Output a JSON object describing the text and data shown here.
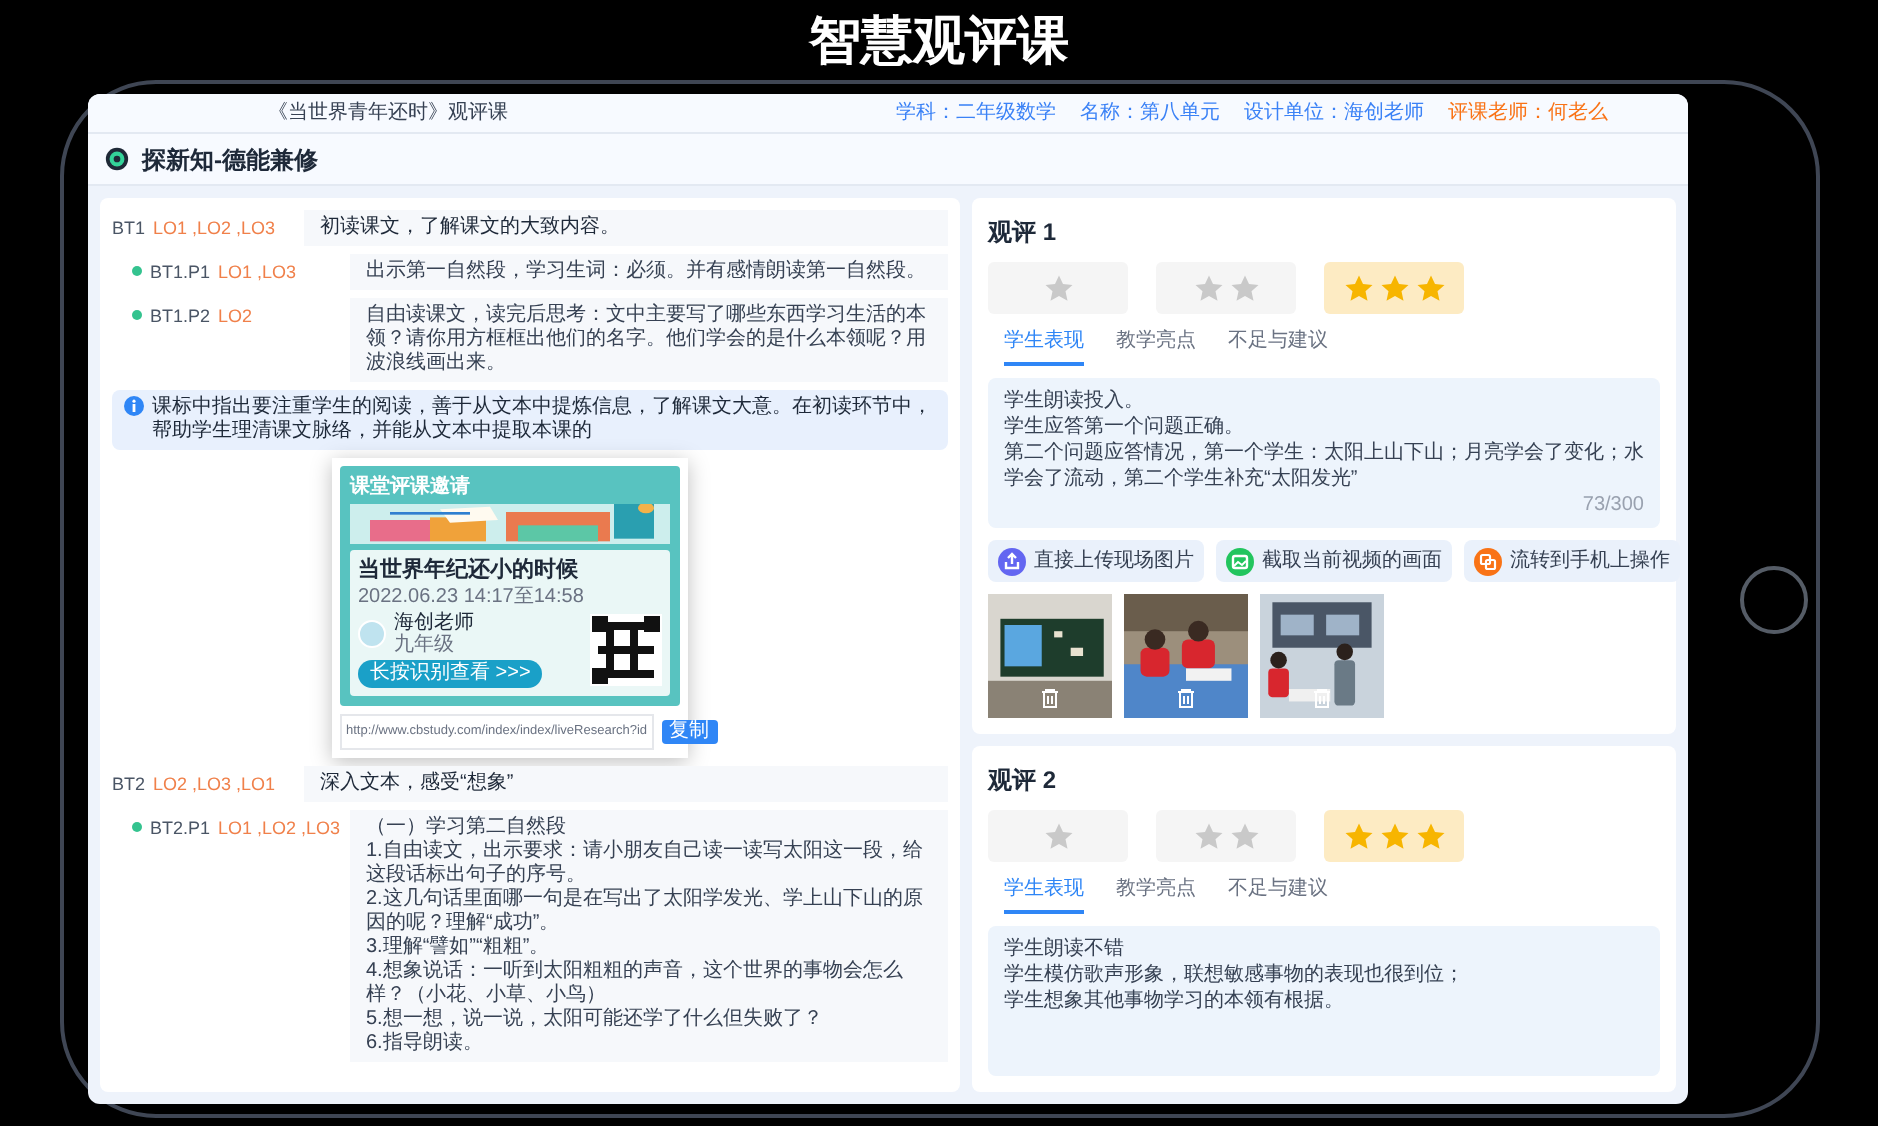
{
  "title": "智慧观评课",
  "header": {
    "course": "《当世界青年还时》观评课",
    "meta": [
      {
        "text": "学科：二年级数学",
        "color": "#3b82f6"
      },
      {
        "text": "名称：第八单元",
        "color": "#3b82f6"
      },
      {
        "text": "设计单位：海创老师",
        "color": "#3b82f6"
      },
      {
        "text": "评课老师：何老么",
        "color": "#f97316"
      }
    ]
  },
  "section_title": "探新知-德能兼修",
  "blocks": [
    {
      "kind": "objective",
      "code": "BT1",
      "tags": "LO1 ,LO2 ,LO3",
      "text": "初读课文，了解课文的大致内容。",
      "children": [
        {
          "code": "BT1.P1",
          "tags": "LO1 ,LO3",
          "lines": [
            "出示第一自然段，学习生词：必须。并有感情朗读第一自然段。"
          ]
        },
        {
          "code": "BT1.P2",
          "tags": "LO2",
          "lines": [
            "自由读课文，读完后思考：文中主要写了哪些东西学习生活的本领？请你用方框框出他们的名字。他们学会的是什么本领呢？用波浪线画出来。"
          ]
        }
      ]
    },
    {
      "kind": "note",
      "text": "课标中指出要注重学生的阅读，善于从文本中提炼信息，了解课文大意。在初读环节中，帮助学生理清课文脉络，并能从文本中提取本课的"
    },
    {
      "kind": "objective",
      "code": "BT2",
      "tags": "LO2 ,LO3 ,LO1",
      "text": "深入文本，感受“想象”",
      "children": [
        {
          "code": "BT2.P1",
          "tags": "LO1 ,LO2 ,LO3",
          "lines": [
            "（一）学习第二自然段",
            "1.自由读文，出示要求：请小朋友自己读一读写太阳这一段，给这段话标出句子的序号。",
            "2.这几句话里面哪一句是在写出了太阳学发光、学上山下山的原因的呢？理解“成功”。",
            "3.理解“譬如”“粗粗”。",
            "4.想象说话：一听到太阳粗粗的声音，这个世界的事物会怎么样？（小花、小草、小鸟）",
            "5.想一想，说一说，太阳可能还学了什么但失败了？",
            "6.指导朗读。"
          ]
        }
      ]
    }
  ],
  "share_popup": {
    "badge": "课堂评课邀请",
    "title": "当世界年纪还小的时候",
    "time": "2022.06.23 14:17至14:58",
    "teacher": "海创老师",
    "role": "九年级",
    "action": "长按识别查看 >>>",
    "url": "http://www.cbstudy.com/index/index/liveResearch?id",
    "copy_button": "复制"
  },
  "reviews": [
    {
      "title": "观评 1",
      "ratings": [
        {
          "kind": "one_star",
          "selected": false
        },
        {
          "kind": "two_stars",
          "selected": false
        },
        {
          "kind": "three_stars",
          "selected": true
        }
      ],
      "tabs": [
        {
          "label": "学生表现",
          "selected": true
        },
        {
          "label": "教学亮点",
          "selected": false
        },
        {
          "label": "不足与建议",
          "selected": false
        }
      ],
      "lines": [
        "学生朗读投入。",
        "学生应答第一个问题正确。",
        "第二个问题应答情况，第一个学生：太阳上山下山；月亮学会了变化；水学会了流动，第二个学生补充“太阳发光”"
      ],
      "counter": "73/300",
      "actions": [
        {
          "kind": "upload",
          "label": "直接上传现场图片",
          "color": "#6366f1"
        },
        {
          "kind": "capture",
          "label": "截取当前视频的画面",
          "color": "#22c55e"
        },
        {
          "kind": "transfer",
          "label": "流转到手机上操作",
          "color": "#f97316"
        }
      ],
      "photos": [
        {
          "kind": "picture"
        },
        {
          "kind": "picture"
        },
        {
          "kind": "picture"
        }
      ]
    },
    {
      "title": "观评 2",
      "ratings": [
        {
          "kind": "one_star",
          "selected": false
        },
        {
          "kind": "two_stars",
          "selected": false
        },
        {
          "kind": "three_stars",
          "selected": true
        }
      ],
      "tabs": [
        {
          "label": "学生表现",
          "selected": true
        },
        {
          "label": "教学亮点",
          "selected": false
        },
        {
          "label": "不足与建议",
          "selected": false
        }
      ],
      "lines": [
        "学生朗读不错",
        "学生模仿歌声形象，联想敏感事物的表现也很到位；",
        "学生想象其他事物学习的本领有根据。"
      ]
    }
  ]
}
